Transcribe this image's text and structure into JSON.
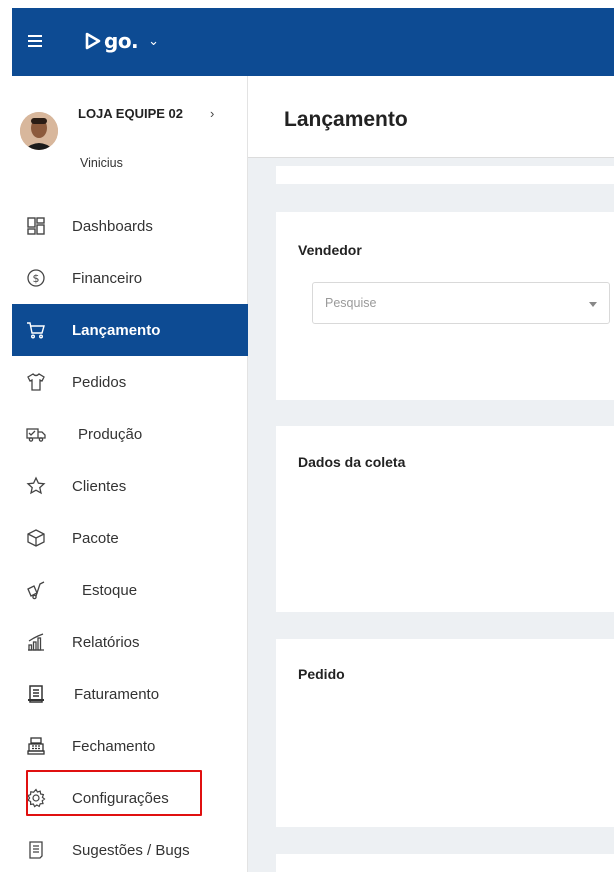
{
  "topbar": {
    "brand": "go.",
    "brand_chevron": "⌄"
  },
  "account": {
    "store": "LOJA EQUIPE 02",
    "store_chevron": "›",
    "user": "Vinicius"
  },
  "nav": {
    "items": [
      {
        "label": "Dashboards",
        "icon": "dashboard-grid-icon"
      },
      {
        "label": "Financeiro",
        "icon": "dollar-circle-icon"
      },
      {
        "label": "Lançamento",
        "icon": "shopping-cart-icon",
        "active": true
      },
      {
        "label": "Pedidos",
        "icon": "shirt-icon"
      },
      {
        "label": "Produção",
        "icon": "truck-icon"
      },
      {
        "label": "Clientes",
        "icon": "star-icon"
      },
      {
        "label": "Pacote",
        "icon": "box-icon"
      },
      {
        "label": "Estoque",
        "icon": "hand-truck-icon"
      },
      {
        "label": "Relatórios",
        "icon": "bar-chart-icon"
      },
      {
        "label": "Faturamento",
        "icon": "receipt-icon"
      },
      {
        "label": "Fechamento",
        "icon": "cash-register-icon"
      },
      {
        "label": "Configurações",
        "icon": "gear-icon",
        "highlighted": true
      },
      {
        "label": "Sugestões / Bugs",
        "icon": "list-icon"
      }
    ]
  },
  "main": {
    "title": "Lançamento",
    "sections": {
      "vendedor": {
        "title": "Vendedor",
        "placeholder": "Pesquise"
      },
      "coleta": {
        "title": "Dados da coleta"
      },
      "pedido": {
        "title": "Pedido"
      }
    }
  },
  "colors": {
    "primary": "#0d4b93",
    "background": "#edf0f3",
    "highlight": "#e01010"
  }
}
